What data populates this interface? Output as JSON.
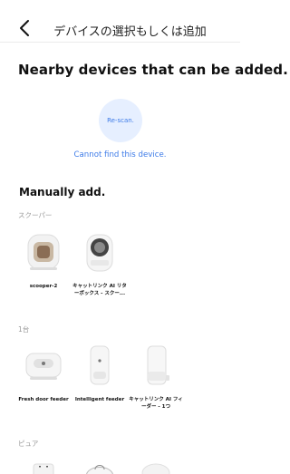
{
  "header": {
    "title": "デバイスの選択もしくは追加"
  },
  "nearby": {
    "title": "Nearby devices that can be added.",
    "rescan_label": "Re-scan.",
    "cannot_find_label": "Cannot find this device."
  },
  "manual": {
    "title": "Manually add.",
    "categories": [
      {
        "label": "スクーパー",
        "devices": [
          {
            "name": "scooper-2",
            "icon": "scooper-2-litter-box-icon"
          },
          {
            "name": "キャットリンク AI リターボックス - スクー...",
            "icon": "ai-litter-box-icon"
          }
        ]
      },
      {
        "label": "1台",
        "devices": [
          {
            "name": "Fresh door feeder",
            "icon": "fresh-door-feeder-icon"
          },
          {
            "name": "Intelligent feeder",
            "icon": "intelligent-feeder-icon"
          },
          {
            "name": "キャットリンク AI フィーダー - 1つ",
            "icon": "ai-feeder-icon"
          }
        ]
      },
      {
        "label": "ピュア",
        "devices": [
          {
            "name": "",
            "icon": "pure-device-icon"
          },
          {
            "name": "",
            "icon": "pure-fountain-icon"
          },
          {
            "name": "",
            "icon": "pure-round-device-icon"
          }
        ]
      }
    ]
  }
}
